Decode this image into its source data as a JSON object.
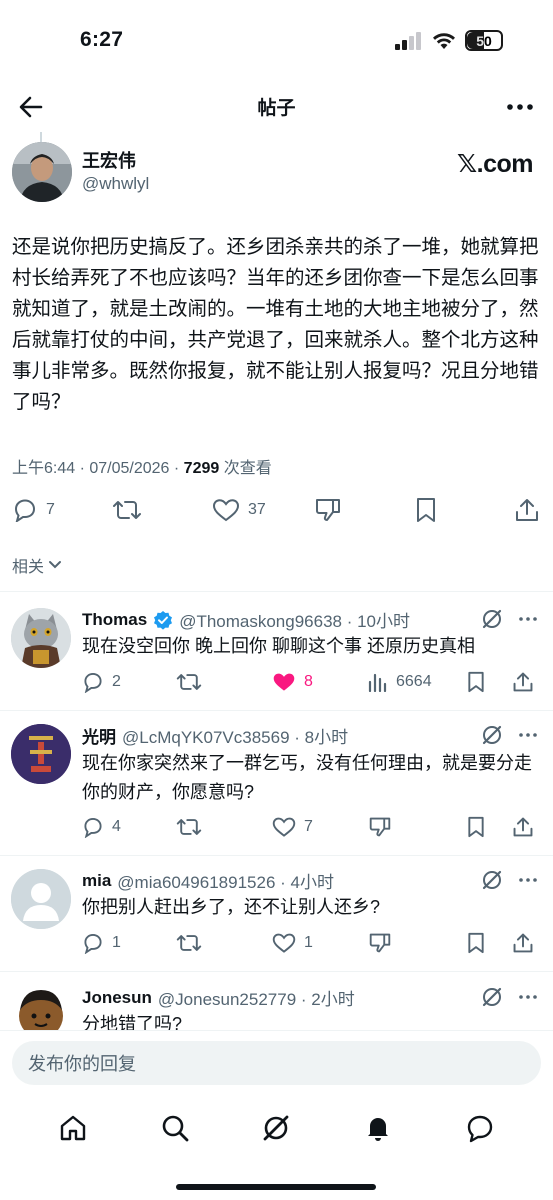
{
  "status_bar": {
    "time": "6:27",
    "battery": "50"
  },
  "header": {
    "title": "帖子"
  },
  "post": {
    "author_name": "王宏伟",
    "author_handle": "@whwlyl",
    "brand": "𝕏.com",
    "body": "还是说你把历史搞反了。还乡团杀亲共的杀了一堆，她就算把村长给弄死了不也应该吗？当年的还乡团你查一下是怎么回事就知道了，就是土改闹的。一堆有土地的大地主地被分了，然后就靠打仗的中间，共产党退了，回来就杀人。整个北方这种事儿非常多。既然你报复，就不能让别人报复吗？况且分地错了吗？",
    "meta_time": "上午6:44 · 07/05/2026 · ",
    "views_count": "7299",
    "views_label": " 次查看",
    "replies": "7",
    "likes": "37"
  },
  "related_label": "相关",
  "replies": [
    {
      "name": "Thomas",
      "verified": true,
      "handle": "@Thomaskong96638 · 10小时",
      "text": "现在没空回你 晚上回你 聊聊这个事 还原历史真相",
      "reply_count": "2",
      "retweet_count": "",
      "like_count": "8",
      "liked": true,
      "view_count": "6664"
    },
    {
      "name": "光明",
      "verified": false,
      "handle": "@LcMqYK07Vc38569 · 8小时",
      "text": "现在你家突然来了一群乞丐，没有任何理由，就是要分走你的财产，你愿意吗?",
      "reply_count": "4",
      "retweet_count": "",
      "like_count": "7",
      "liked": false,
      "view_count": ""
    },
    {
      "name": "mia",
      "verified": false,
      "handle": "@mia604961891526 · 4小时",
      "text": "你把别人赶出乡了，还不让别人还乡?",
      "reply_count": "1",
      "retweet_count": "",
      "like_count": "1",
      "liked": false,
      "view_count": ""
    },
    {
      "name": "Jonesun",
      "verified": false,
      "handle": "@Jonesun252779 · 2小时",
      "text": "分地错了吗?",
      "reply_count": "",
      "retweet_count": "",
      "like_count": "",
      "liked": false,
      "view_count": ""
    }
  ],
  "compose": {
    "placeholder": "发布你的回复"
  },
  "tabs": [
    "home-icon",
    "search-icon",
    "grok-icon",
    "notifications-icon",
    "messages-icon"
  ],
  "colors": {
    "like_pink": "#f91880",
    "verified_blue": "#1d9bf0",
    "secondary_text": "#536471"
  }
}
